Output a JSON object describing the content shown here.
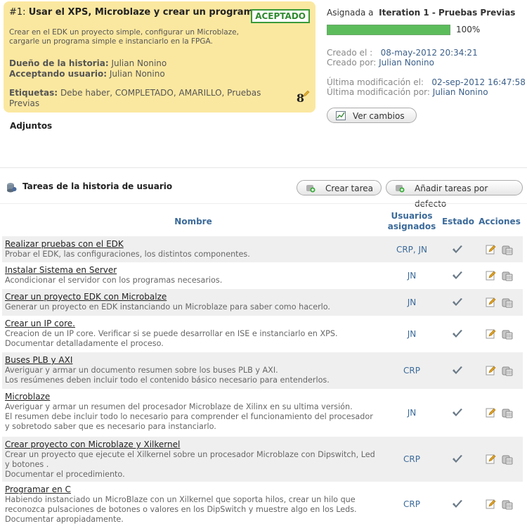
{
  "story": {
    "number": "#1:",
    "title": "Usar el XPS, Microblaze y crear un programa.",
    "status": "ACEPTADO",
    "description": "Crear en el EDK un proyecto simple, configurar un Microblaze, cargarle un programa simple e instanciarlo en la FPGA.",
    "owner_label": "Dueño de la historia",
    "owner": "Julian Nonino",
    "accepting_label": "Acceptando usuario",
    "accepting": "Julian Nonino",
    "tags_label": "Etiquetas",
    "tags": "Debe haber, COMPLETADO, AMARILLO, Pruebas Previas",
    "points": "8",
    "attachments_label": "Adjuntos"
  },
  "assignment": {
    "label": "Asignada a",
    "iteration": "Iteration 1 - Pruebas Previas",
    "progress_percent": 100,
    "progress_text": "100%",
    "created_on_label": "Creado el :",
    "created_on": "08-may-2012 20:34:21",
    "created_by_label": "Creado por:",
    "created_by": "Julian Nonino",
    "modified_on_label": "Última modificación el:",
    "modified_on": "02-sep-2012 16:47:58",
    "modified_by_label": "Última modificación por:",
    "modified_by": "Julian Nonino",
    "view_changes_button": "Ver cambios"
  },
  "tasks_section": {
    "title": "Tareas de la historia de usuario",
    "create_button": "Crear tarea",
    "add_default_button": "Añadir tareas por defecto",
    "headers": {
      "name": "Nombre",
      "users_line1": "Usuarios",
      "users_line2": "asignados",
      "state": "Estado",
      "actions": "Acciones"
    },
    "tasks": [
      {
        "name": "Realizar pruebas con el EDK",
        "desc": "Probar el EDK, las configuraciones, los distintos componentes.",
        "users": "CRP, JN"
      },
      {
        "name": "Instalar Sistema en Server",
        "desc": "Acondicionar el servidor con los programas necesarios.",
        "users": "JN"
      },
      {
        "name": "Crear un proyecto EDK con Microbalze",
        "desc": "Generar un proyecto en EDK instanciando un Microblaze para saber como hacerlo.",
        "users": "JN"
      },
      {
        "name": "Crear un IP core.",
        "desc": "Creacion de un IP core. Verificar si se puede desarrollar en ISE e instanciarlo en XPS.\nDocumentar detalladamente el proceso.",
        "users": "JN"
      },
      {
        "name": "Buses PLB y AXI",
        "desc": "Averiguar y armar un documento resumen sobre los buses PLB y AXI.\nLos resúmenes deben incluir todo el contenido básico necesario para entenderlos.",
        "users": "CRP"
      },
      {
        "name": "Microblaze",
        "desc": "Averiguar y armar un resumen del procesador Microblaze de Xilinx en su ultima versión.\nEl resumen debe incluir todo lo necesario para comprender el funcionamiento del procesador y sobretodo saber que es necesario para instanciarlo.",
        "users": "JN"
      },
      {
        "name": "Crear proyecto con Microblaze y Xilkernel",
        "desc": "Crear un proyecto que ejecute el Xilkernel sobre un procesador Microblaze con Dipswitch, Led y botones .\nDocumentar el procedimiento.",
        "users": "CRP"
      },
      {
        "name": "Programar en C",
        "desc": "Habiendo instanciado un MicroBlaze con un Xilkernel que soporta hilos, crear un hilo que reconozca pulsaciones de botones o valores en los DipSwitch y muestre algo en los Leds.\nDocumentar apropiadamente.",
        "users": "CRP"
      }
    ]
  },
  "colors": {
    "card_bg": "#fbe8a0",
    "accept_green": "#2f8a2f",
    "progress_green": "#5cbc5c",
    "link_blue": "#3b6a9a"
  }
}
